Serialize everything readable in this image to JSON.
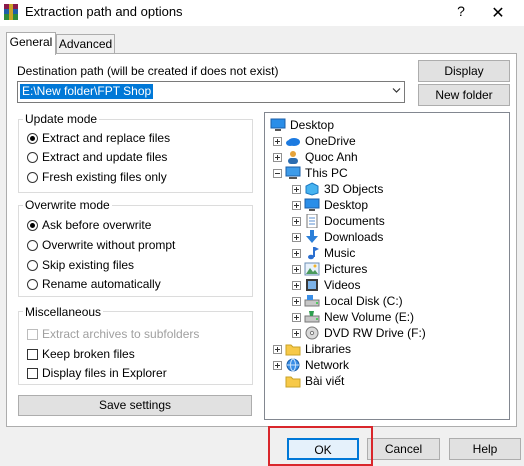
{
  "window": {
    "title": "Extraction path and options",
    "help": "?",
    "close": "✕"
  },
  "tabs": [
    {
      "label": "General"
    },
    {
      "label": "Advanced"
    }
  ],
  "destination": {
    "label": "Destination path (will be created if does not exist)",
    "value": "E:\\New folder\\FPT Shop",
    "display_button": "Display",
    "new_folder_button": "New folder"
  },
  "update_mode": {
    "title": "Update mode",
    "options": [
      {
        "label": "Extract and replace files",
        "selected": true
      },
      {
        "label": "Extract and update files",
        "selected": false
      },
      {
        "label": "Fresh existing files only",
        "selected": false
      }
    ]
  },
  "overwrite_mode": {
    "title": "Overwrite mode",
    "options": [
      {
        "label": "Ask before overwrite",
        "selected": true
      },
      {
        "label": "Overwrite without prompt",
        "selected": false
      },
      {
        "label": "Skip existing files",
        "selected": false
      },
      {
        "label": "Rename automatically",
        "selected": false
      }
    ]
  },
  "misc": {
    "title": "Miscellaneous",
    "options": [
      {
        "label": "Extract archives to subfolders",
        "checked": false,
        "disabled": true
      },
      {
        "label": "Keep broken files",
        "checked": false,
        "disabled": false
      },
      {
        "label": "Display files in Explorer",
        "checked": false,
        "disabled": false
      }
    ]
  },
  "save_settings": "Save settings",
  "tree": [
    {
      "label": "Desktop",
      "icon": "desktop-icon"
    },
    {
      "label": "OneDrive",
      "icon": "cloud-icon"
    },
    {
      "label": "Quoc Anh",
      "icon": "user-icon"
    },
    {
      "label": "This PC",
      "icon": "computer-icon"
    },
    {
      "label": "3D Objects",
      "icon": "cube-icon"
    },
    {
      "label": "Desktop",
      "icon": "desktop-icon"
    },
    {
      "label": "Documents",
      "icon": "document-icon"
    },
    {
      "label": "Downloads",
      "icon": "download-icon"
    },
    {
      "label": "Music",
      "icon": "music-icon"
    },
    {
      "label": "Pictures",
      "icon": "picture-icon"
    },
    {
      "label": "Videos",
      "icon": "video-icon"
    },
    {
      "label": "Local Disk (C:)",
      "icon": "drive-icon"
    },
    {
      "label": "New Volume (E:)",
      "icon": "drive-icon"
    },
    {
      "label": "DVD RW Drive (F:)",
      "icon": "dvd-icon"
    },
    {
      "label": "Libraries",
      "icon": "folder-icon"
    },
    {
      "label": "Network",
      "icon": "network-icon"
    },
    {
      "label": "Bài viết",
      "icon": "folder-icon"
    }
  ],
  "footer": {
    "ok": "OK",
    "cancel": "Cancel",
    "help": "Help"
  },
  "colors": {
    "accent": "#0078d7",
    "highlight": "#d9262b"
  }
}
